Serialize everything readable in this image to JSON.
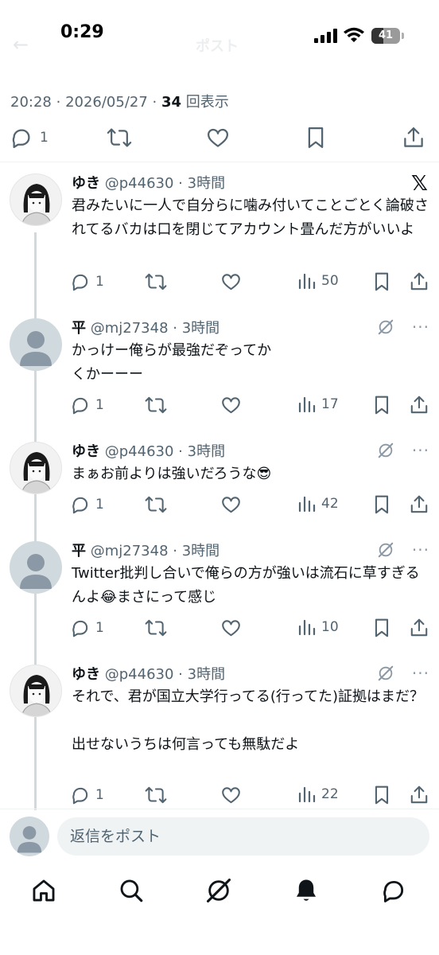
{
  "status_bar": {
    "time": "0:29",
    "battery": "41",
    "battery_level": 0.41,
    "faded_back": "←",
    "faded_title": "ポスト"
  },
  "post_meta": {
    "time": "20:28",
    "date": "2026/05/27",
    "views_count": "34",
    "views_label": "回表示"
  },
  "main_actions": {
    "reply_count": "1"
  },
  "replies": [
    {
      "name": "ゆき",
      "handle": "@p44630",
      "age": "3時間",
      "text": "君みたいに一人で自分らに噛み付いてことごとく論破されてるバカは口を閉じてアカウント畳んだ方がいいよ",
      "replies": "1",
      "views": "50"
    },
    {
      "name": "平",
      "handle": "@mj27348",
      "age": "3時間",
      "text": "かっけー俺らが最強だぞってか\nくかーーー",
      "replies": "1",
      "views": "17"
    },
    {
      "name": "ゆき",
      "handle": "@p44630",
      "age": "3時間",
      "text": "まぁお前よりは強いだろうな😎",
      "replies": "1",
      "views": "42"
    },
    {
      "name": "平",
      "handle": "@mj27348",
      "age": "3時間",
      "text": "Twitter批判し合いで俺らの方が強いは流石に草すぎるんよ😂まさにって感じ",
      "replies": "1",
      "views": "10"
    },
    {
      "name": "ゆき",
      "handle": "@p44630",
      "age": "3時間",
      "text": "それで、君が国立大学行ってる(行ってた)証拠はまだ？\n\n出せないうちは何言っても無駄だよ",
      "replies": "1",
      "views": "22"
    }
  ],
  "composer": {
    "placeholder": "返信をポスト"
  },
  "icons": {
    "reply": "reply-icon",
    "repost": "repost-icon",
    "like": "like-icon",
    "bookmark": "bookmark-icon",
    "share": "share-icon",
    "views": "views-icon",
    "grok": "grok-icon",
    "x_logo": "x-logo-icon",
    "more": "more-icon"
  },
  "bottom_nav": [
    "home-icon",
    "search-icon",
    "grok-icon",
    "notifications-icon",
    "messages-icon"
  ],
  "colors": {
    "text": "#0f1419",
    "secondary": "#536471",
    "divider": "#eff3f4",
    "thread_line": "#cfd9de",
    "icon": "#536471"
  }
}
